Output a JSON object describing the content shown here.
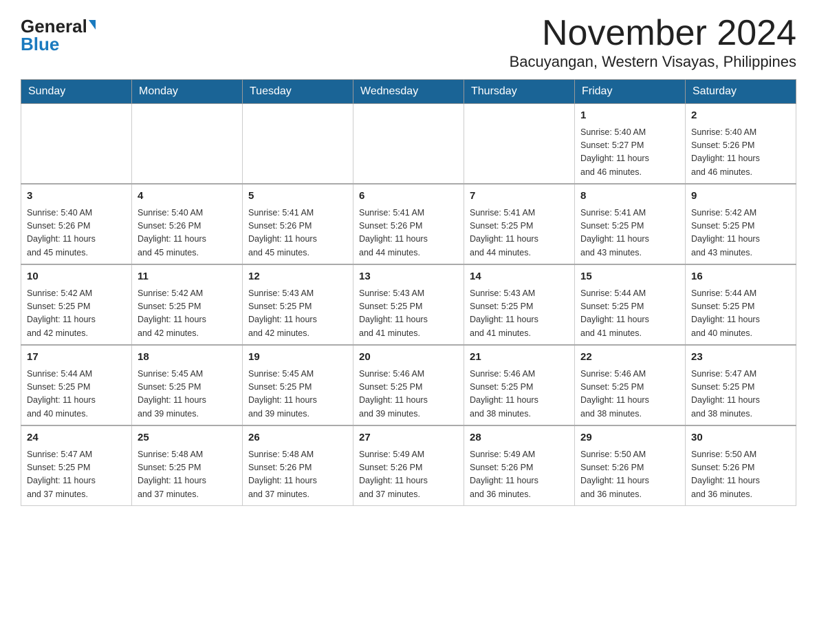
{
  "header": {
    "logo_general": "General",
    "logo_blue": "Blue",
    "month_title": "November 2024",
    "location": "Bacuyangan, Western Visayas, Philippines"
  },
  "days_of_week": [
    "Sunday",
    "Monday",
    "Tuesday",
    "Wednesday",
    "Thursday",
    "Friday",
    "Saturday"
  ],
  "weeks": [
    [
      {
        "day": "",
        "info": ""
      },
      {
        "day": "",
        "info": ""
      },
      {
        "day": "",
        "info": ""
      },
      {
        "day": "",
        "info": ""
      },
      {
        "day": "",
        "info": ""
      },
      {
        "day": "1",
        "info": "Sunrise: 5:40 AM\nSunset: 5:27 PM\nDaylight: 11 hours\nand 46 minutes."
      },
      {
        "day": "2",
        "info": "Sunrise: 5:40 AM\nSunset: 5:26 PM\nDaylight: 11 hours\nand 46 minutes."
      }
    ],
    [
      {
        "day": "3",
        "info": "Sunrise: 5:40 AM\nSunset: 5:26 PM\nDaylight: 11 hours\nand 45 minutes."
      },
      {
        "day": "4",
        "info": "Sunrise: 5:40 AM\nSunset: 5:26 PM\nDaylight: 11 hours\nand 45 minutes."
      },
      {
        "day": "5",
        "info": "Sunrise: 5:41 AM\nSunset: 5:26 PM\nDaylight: 11 hours\nand 45 minutes."
      },
      {
        "day": "6",
        "info": "Sunrise: 5:41 AM\nSunset: 5:26 PM\nDaylight: 11 hours\nand 44 minutes."
      },
      {
        "day": "7",
        "info": "Sunrise: 5:41 AM\nSunset: 5:25 PM\nDaylight: 11 hours\nand 44 minutes."
      },
      {
        "day": "8",
        "info": "Sunrise: 5:41 AM\nSunset: 5:25 PM\nDaylight: 11 hours\nand 43 minutes."
      },
      {
        "day": "9",
        "info": "Sunrise: 5:42 AM\nSunset: 5:25 PM\nDaylight: 11 hours\nand 43 minutes."
      }
    ],
    [
      {
        "day": "10",
        "info": "Sunrise: 5:42 AM\nSunset: 5:25 PM\nDaylight: 11 hours\nand 42 minutes."
      },
      {
        "day": "11",
        "info": "Sunrise: 5:42 AM\nSunset: 5:25 PM\nDaylight: 11 hours\nand 42 minutes."
      },
      {
        "day": "12",
        "info": "Sunrise: 5:43 AM\nSunset: 5:25 PM\nDaylight: 11 hours\nand 42 minutes."
      },
      {
        "day": "13",
        "info": "Sunrise: 5:43 AM\nSunset: 5:25 PM\nDaylight: 11 hours\nand 41 minutes."
      },
      {
        "day": "14",
        "info": "Sunrise: 5:43 AM\nSunset: 5:25 PM\nDaylight: 11 hours\nand 41 minutes."
      },
      {
        "day": "15",
        "info": "Sunrise: 5:44 AM\nSunset: 5:25 PM\nDaylight: 11 hours\nand 41 minutes."
      },
      {
        "day": "16",
        "info": "Sunrise: 5:44 AM\nSunset: 5:25 PM\nDaylight: 11 hours\nand 40 minutes."
      }
    ],
    [
      {
        "day": "17",
        "info": "Sunrise: 5:44 AM\nSunset: 5:25 PM\nDaylight: 11 hours\nand 40 minutes."
      },
      {
        "day": "18",
        "info": "Sunrise: 5:45 AM\nSunset: 5:25 PM\nDaylight: 11 hours\nand 39 minutes."
      },
      {
        "day": "19",
        "info": "Sunrise: 5:45 AM\nSunset: 5:25 PM\nDaylight: 11 hours\nand 39 minutes."
      },
      {
        "day": "20",
        "info": "Sunrise: 5:46 AM\nSunset: 5:25 PM\nDaylight: 11 hours\nand 39 minutes."
      },
      {
        "day": "21",
        "info": "Sunrise: 5:46 AM\nSunset: 5:25 PM\nDaylight: 11 hours\nand 38 minutes."
      },
      {
        "day": "22",
        "info": "Sunrise: 5:46 AM\nSunset: 5:25 PM\nDaylight: 11 hours\nand 38 minutes."
      },
      {
        "day": "23",
        "info": "Sunrise: 5:47 AM\nSunset: 5:25 PM\nDaylight: 11 hours\nand 38 minutes."
      }
    ],
    [
      {
        "day": "24",
        "info": "Sunrise: 5:47 AM\nSunset: 5:25 PM\nDaylight: 11 hours\nand 37 minutes."
      },
      {
        "day": "25",
        "info": "Sunrise: 5:48 AM\nSunset: 5:25 PM\nDaylight: 11 hours\nand 37 minutes."
      },
      {
        "day": "26",
        "info": "Sunrise: 5:48 AM\nSunset: 5:26 PM\nDaylight: 11 hours\nand 37 minutes."
      },
      {
        "day": "27",
        "info": "Sunrise: 5:49 AM\nSunset: 5:26 PM\nDaylight: 11 hours\nand 37 minutes."
      },
      {
        "day": "28",
        "info": "Sunrise: 5:49 AM\nSunset: 5:26 PM\nDaylight: 11 hours\nand 36 minutes."
      },
      {
        "day": "29",
        "info": "Sunrise: 5:50 AM\nSunset: 5:26 PM\nDaylight: 11 hours\nand 36 minutes."
      },
      {
        "day": "30",
        "info": "Sunrise: 5:50 AM\nSunset: 5:26 PM\nDaylight: 11 hours\nand 36 minutes."
      }
    ]
  ]
}
